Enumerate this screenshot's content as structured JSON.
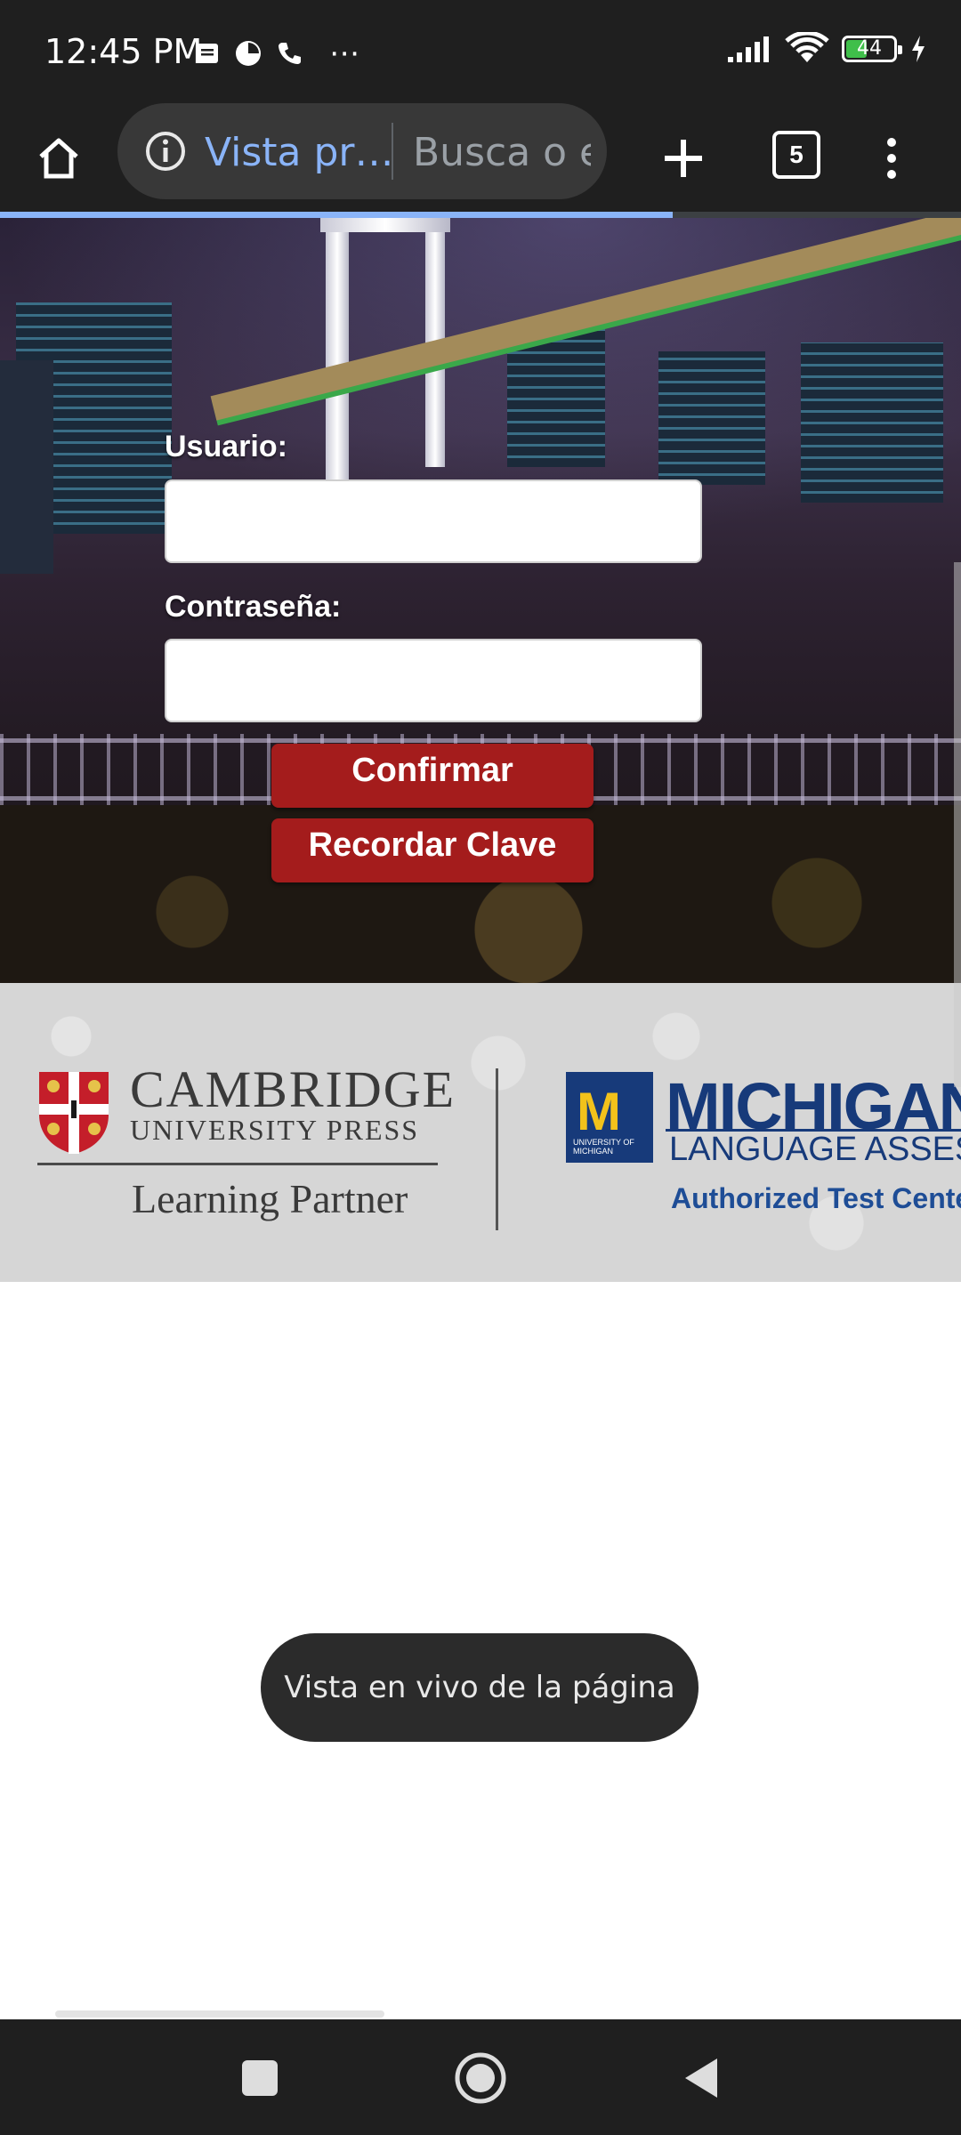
{
  "status_bar": {
    "time": "12:45 PM",
    "battery": "44",
    "battery_fraction": 0.44,
    "more_icon": "⋯"
  },
  "browser": {
    "url_label": "Vista pr…",
    "search_placeholder": "Busca o es",
    "tab_count": "5",
    "load_progress": 0.7,
    "accent": "#8ab4f8"
  },
  "login": {
    "username_label": "Usuario:",
    "password_label": "Contraseña:",
    "username_value": "",
    "password_value": "",
    "confirm_label": "Confirmar",
    "remember_label": "Recordar Clave",
    "button_color": "#a41c1c"
  },
  "logos": {
    "cambridge_name": "CAMBRIDGE",
    "cambridge_press": "UNIVERSITY PRESS",
    "cambridge_partner": "Learning Partner",
    "michigan_block": "M",
    "michigan_block_sub": "UNIVERSITY OF MICHIGAN",
    "michigan_title": "MICHIGAN",
    "michigan_subtitle": "LANGUAGE ASSESSMENT",
    "michigan_authorized": "Authorized Test Center"
  },
  "toast": {
    "text": "Vista en vivo de la página"
  }
}
